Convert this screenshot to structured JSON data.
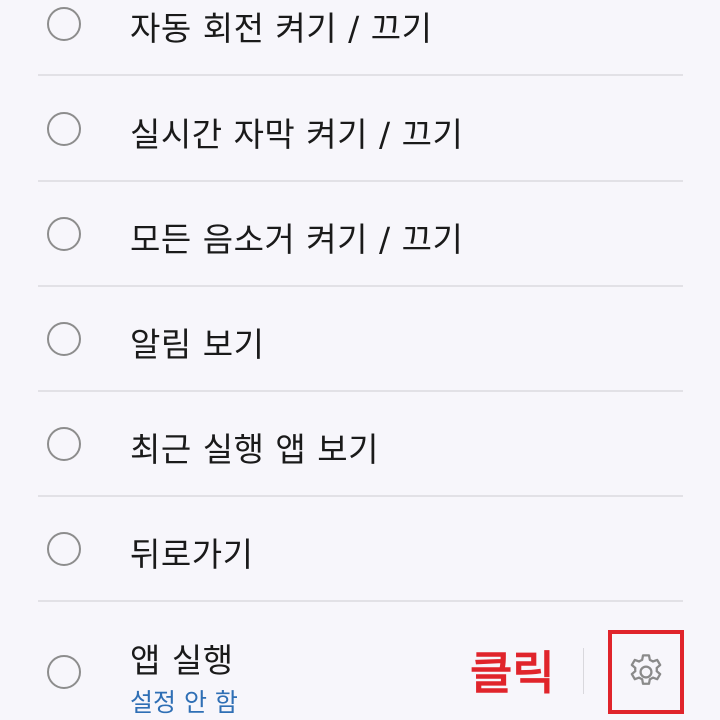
{
  "items": [
    {
      "label": "자동 회전 켜기 / 끄기"
    },
    {
      "label": "실시간 자막 켜기 / 끄기"
    },
    {
      "label": "모든 음소거 켜기 / 끄기"
    },
    {
      "label": "알림 보기"
    },
    {
      "label": "최근 실행 앱 보기"
    },
    {
      "label": "뒤로가기"
    },
    {
      "label": "앱 실행",
      "sublabel": "설정 안 함"
    }
  ],
  "annotation": {
    "click_label": "클릭"
  },
  "icons": {
    "settings": "gear-icon"
  },
  "colors": {
    "accent_link": "#2f6fb5",
    "annotation_red": "#e0242b",
    "background": "#f7f6fb"
  }
}
